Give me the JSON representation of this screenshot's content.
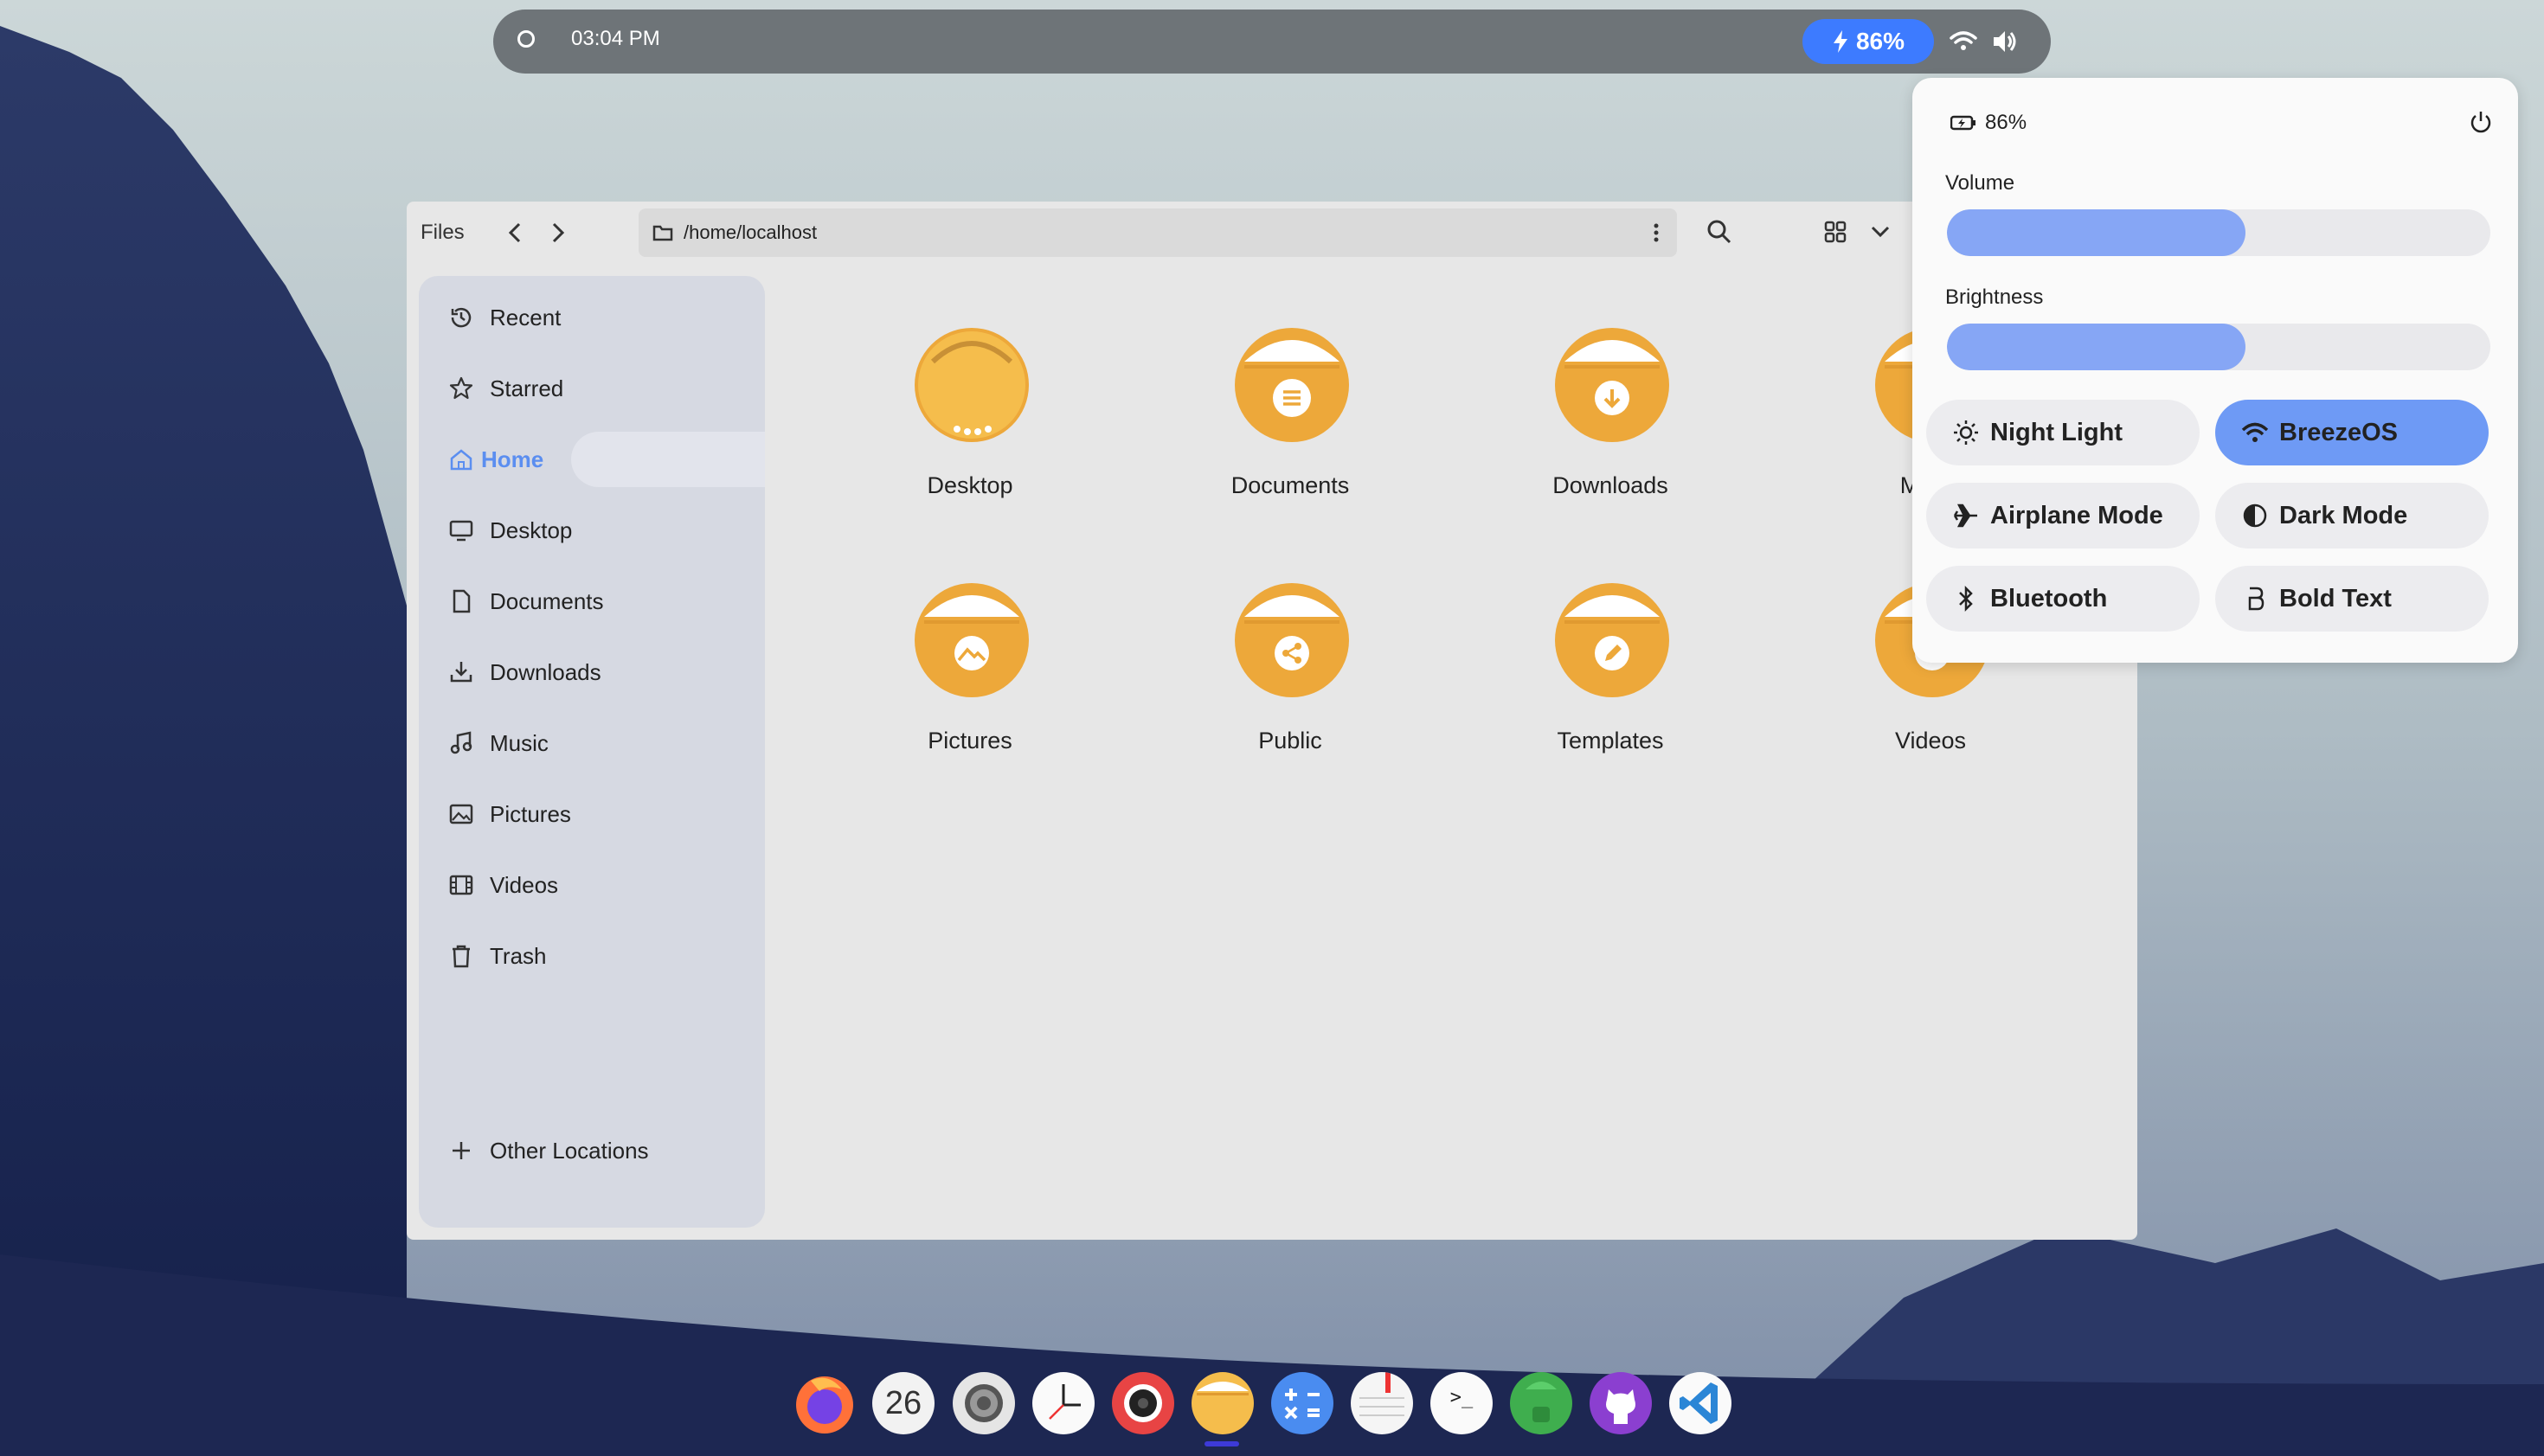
{
  "topbar": {
    "clock": "03:04 PM",
    "battery": "86%",
    "colors": {
      "bar": "#6e7478",
      "battery_pill": "#3d7bff"
    }
  },
  "window": {
    "title": "Files",
    "path": "/home/localhost"
  },
  "sidebar": {
    "items": [
      {
        "label": "Recent",
        "icon": "clock-history-icon"
      },
      {
        "label": "Starred",
        "icon": "star-icon"
      },
      {
        "label": "Home",
        "icon": "home-icon",
        "active": true
      },
      {
        "label": "Desktop",
        "icon": "monitor-icon"
      },
      {
        "label": "Documents",
        "icon": "document-icon"
      },
      {
        "label": "Downloads",
        "icon": "download-icon"
      },
      {
        "label": "Music",
        "icon": "music-note-icon"
      },
      {
        "label": "Pictures",
        "icon": "image-icon"
      },
      {
        "label": "Videos",
        "icon": "film-icon"
      },
      {
        "label": "Trash",
        "icon": "trash-icon"
      }
    ],
    "other_locations": "Other Locations"
  },
  "folders": [
    {
      "label": "Desktop",
      "icon": "folder-desktop-icon"
    },
    {
      "label": "Documents",
      "icon": "folder-documents-icon"
    },
    {
      "label": "Downloads",
      "icon": "folder-downloads-icon"
    },
    {
      "label": "Music",
      "icon": "folder-music-icon"
    },
    {
      "label": "Pictures",
      "icon": "folder-pictures-icon"
    },
    {
      "label": "Public",
      "icon": "folder-public-icon"
    },
    {
      "label": "Templates",
      "icon": "folder-templates-icon"
    },
    {
      "label": "Videos",
      "icon": "folder-videos-icon"
    }
  ],
  "quick_settings": {
    "battery": "86%",
    "volume_label": "Volume",
    "volume_level": 0.55,
    "brightness_label": "Brightness",
    "brightness_level": 0.55,
    "tiles": [
      {
        "label": "Night Light",
        "icon": "sun-icon",
        "on": false
      },
      {
        "label": "BreezeOS",
        "icon": "wifi-icon",
        "on": true
      },
      {
        "label": "Airplane Mode",
        "icon": "airplane-icon",
        "on": false
      },
      {
        "label": "Dark Mode",
        "icon": "half-circle-icon",
        "on": false
      },
      {
        "label": "Bluetooth",
        "icon": "bluetooth-icon",
        "on": false
      },
      {
        "label": "Bold Text",
        "icon": "bold-b-icon",
        "on": false
      }
    ],
    "accent": "#6e9af5"
  },
  "dock": {
    "apps": [
      {
        "name": "firefox"
      },
      {
        "name": "calendar",
        "label": "26"
      },
      {
        "name": "settings"
      },
      {
        "name": "clock"
      },
      {
        "name": "camera"
      },
      {
        "name": "files",
        "active": true
      },
      {
        "name": "calculator"
      },
      {
        "name": "text-editor"
      },
      {
        "name": "terminal",
        "label": ">_"
      },
      {
        "name": "android"
      },
      {
        "name": "github"
      },
      {
        "name": "vscode"
      }
    ]
  }
}
